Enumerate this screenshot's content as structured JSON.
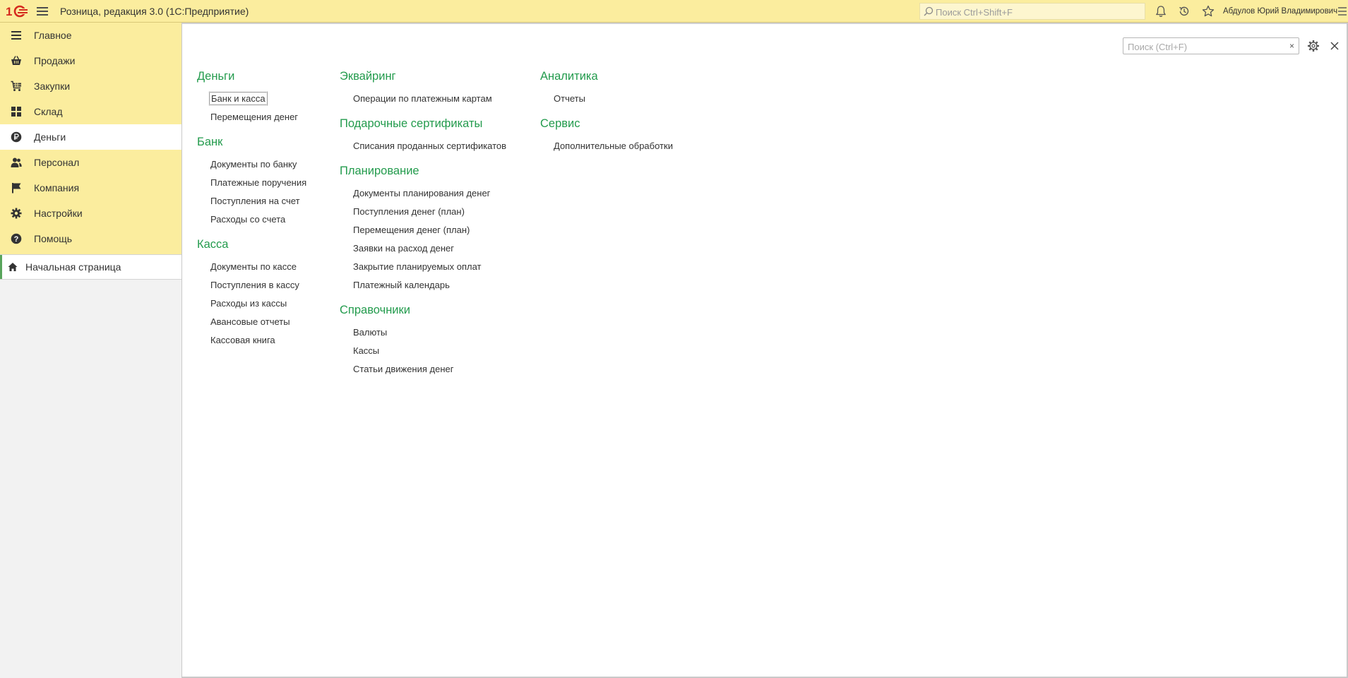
{
  "app": {
    "title": "Розница, редакция 3.0  (1С:Предприятие)",
    "search_placeholder": "Поиск Ctrl+Shift+F",
    "user": "Абдулов Юрий Владимирович"
  },
  "icons": {
    "logo": "1c-logo-icon",
    "menu": "hamburger-menu-icon",
    "search": "search-icon",
    "notifications": "bell-icon",
    "history": "history-icon",
    "favorites": "star-icon",
    "settings": "gear-icon",
    "close": "close-icon"
  },
  "sidebar": {
    "sections": [
      {
        "label": "Главное",
        "icon": "list-icon"
      },
      {
        "label": "Продажи",
        "icon": "basket-icon"
      },
      {
        "label": "Закупки",
        "icon": "cart-icon"
      },
      {
        "label": "Склад",
        "icon": "warehouse-grid-icon"
      },
      {
        "label": "Деньги",
        "icon": "ruble-coin-icon",
        "active": true
      },
      {
        "label": "Персонал",
        "icon": "people-icon"
      },
      {
        "label": "Компания",
        "icon": "flag-icon"
      },
      {
        "label": "Настройки",
        "icon": "gear-icon"
      },
      {
        "label": "Помощь",
        "icon": "help-icon"
      }
    ],
    "open_windows": [
      {
        "label": "Начальная страница",
        "icon": "home-icon"
      }
    ]
  },
  "main": {
    "search_placeholder": "Поиск (Ctrl+F)",
    "clear_label": "×",
    "columns": [
      [
        {
          "title": "Деньги",
          "links": [
            "Банк и касса",
            "Перемещения денег"
          ]
        },
        {
          "title": "Банк",
          "links": [
            "Документы по банку",
            "Платежные поручения",
            "Поступления на счет",
            "Расходы со счета"
          ]
        },
        {
          "title": "Касса",
          "links": [
            "Документы по кассе",
            "Поступления в кассу",
            "Расходы из кассы",
            "Авансовые отчеты",
            "Кассовая книга"
          ]
        }
      ],
      [
        {
          "title": "Эквайринг",
          "links": [
            "Операции по платежным картам"
          ]
        },
        {
          "title": "Подарочные сертификаты",
          "links": [
            "Списания проданных сертификатов"
          ]
        },
        {
          "title": "Планирование",
          "links": [
            "Документы планирования денег",
            "Поступления денег (план)",
            "Перемещения денег (план)",
            "Заявки на расход денег",
            "Закрытие планируемых оплат",
            "Платежный календарь"
          ]
        },
        {
          "title": "Справочники",
          "links": [
            "Валюты",
            "Кассы",
            "Статьи движения денег"
          ]
        }
      ],
      [
        {
          "title": "Аналитика",
          "links": [
            "Отчеты"
          ]
        },
        {
          "title": "Сервис",
          "links": [
            "Дополнительные обработки"
          ]
        }
      ]
    ]
  },
  "colors": {
    "top_bar": "#fbed9e",
    "group_title": "#239b4d",
    "active_marker": "#58a45b"
  }
}
